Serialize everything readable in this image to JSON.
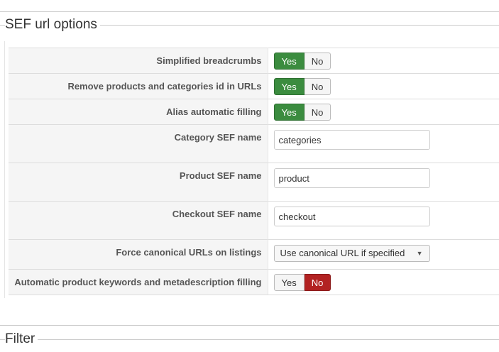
{
  "section_title": "SEF url options",
  "next_section_title": "Filter",
  "rows": [
    {
      "label": "Simplified breadcrumbs",
      "type": "toggle",
      "yes": "Yes",
      "no": "No",
      "active": "yes"
    },
    {
      "label": "Remove products and categories id in URLs",
      "type": "toggle",
      "yes": "Yes",
      "no": "No",
      "active": "yes"
    },
    {
      "label": "Alias automatic filling",
      "type": "toggle",
      "yes": "Yes",
      "no": "No",
      "active": "yes"
    },
    {
      "label": "Category SEF name",
      "type": "text",
      "value": "categories"
    },
    {
      "label": "Product SEF name",
      "type": "text",
      "value": "product"
    },
    {
      "label": "Checkout SEF name",
      "type": "text",
      "value": "checkout"
    },
    {
      "label": "Force canonical URLs on listings",
      "type": "select",
      "value": "Use canonical URL if specified"
    },
    {
      "label": "Automatic product keywords and metadescription filling",
      "type": "toggle",
      "yes": "Yes",
      "no": "No",
      "active": "no"
    }
  ],
  "colors": {
    "yes_active": "#3b8c3f",
    "no_active": "#b22222"
  }
}
